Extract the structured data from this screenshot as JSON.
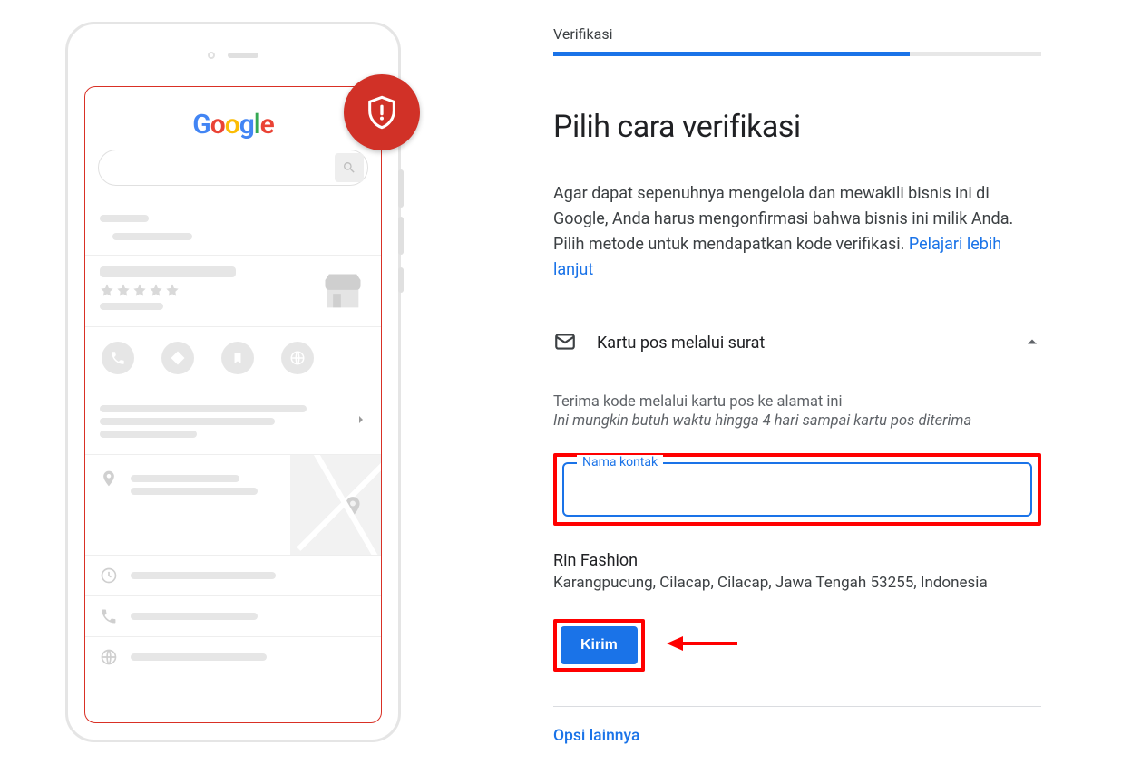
{
  "step_label": "Verifikasi",
  "heading": "Pilih cara verifikasi",
  "description": "Agar dapat sepenuhnya mengelola dan mewakili bisnis ini di Google, Anda harus mengonfirmasi bahwa bisnis ini milik Anda. Pilih metode untuk mendapatkan kode verifikasi.",
  "learn_more": "Pelajari lebih lanjut",
  "method": {
    "label": "Kartu pos melalui surat"
  },
  "sub": {
    "line1": "Terima kode melalui kartu pos ke alamat ini",
    "line2": "Ini mungkin butuh waktu hingga 4 hari sampai kartu pos diterima"
  },
  "input": {
    "label": "Nama kontak",
    "value": ""
  },
  "business": {
    "name": "Rin Fashion",
    "address": "Karangpucung, Cilacap, Cilacap, Jawa Tengah 53255, Indonesia"
  },
  "send_button": "Kirim",
  "other_options": "Opsi lainnya",
  "logo": "Google"
}
